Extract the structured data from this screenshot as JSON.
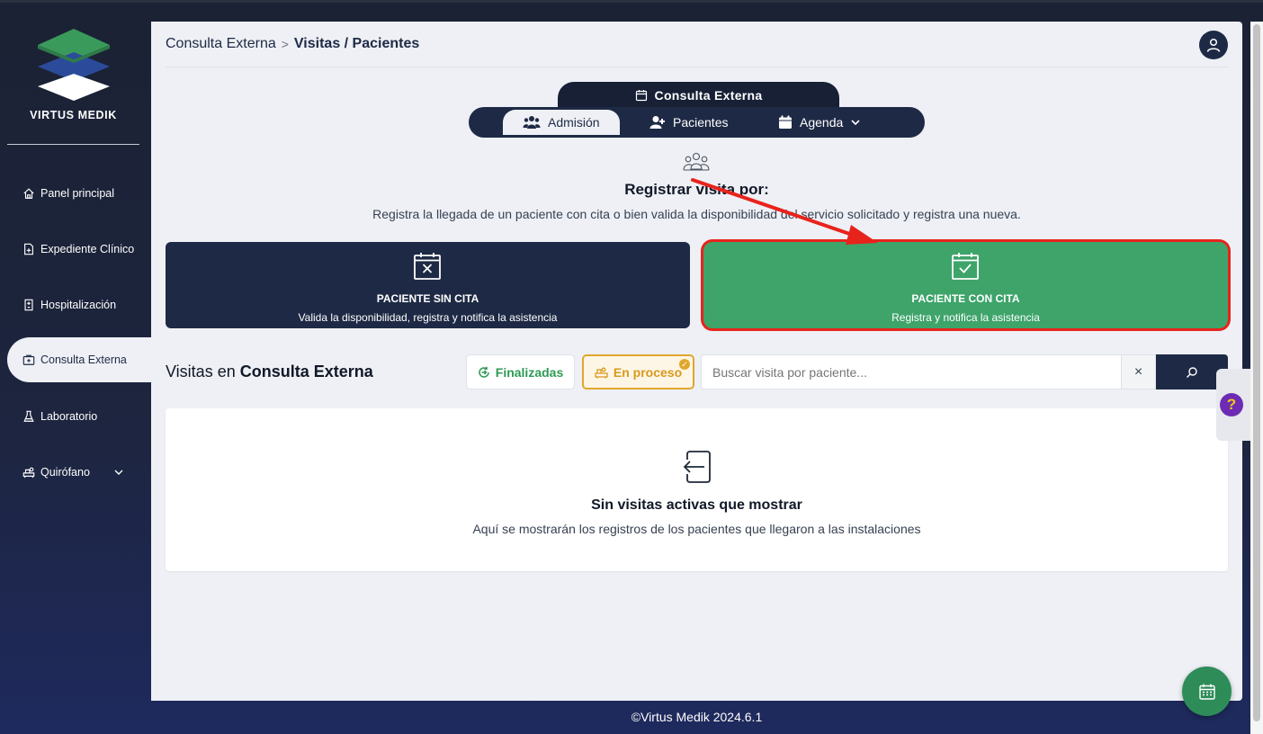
{
  "sidebar": {
    "brand": "VIRTUS MEDIK",
    "items": [
      {
        "label": "Panel principal",
        "icon": "home-icon"
      },
      {
        "label": "Expediente Clínico",
        "icon": "file-plus-icon"
      },
      {
        "label": "Hospitalización",
        "icon": "hospital-icon"
      },
      {
        "label": "Consulta Externa",
        "icon": "clinic-icon",
        "active": true
      },
      {
        "label": "Laboratorio",
        "icon": "flask-icon"
      },
      {
        "label": "Quirófano",
        "icon": "surgery-icon"
      }
    ]
  },
  "header": {
    "breadcrumb_parent": "Consulta Externa",
    "breadcrumb_separator": ">",
    "breadcrumb_current": "Visitas / Pacientes"
  },
  "tabs": {
    "section_title": "Consulta Externa",
    "items": [
      {
        "label": "Admisión",
        "active": true
      },
      {
        "label": "Pacientes"
      },
      {
        "label": "Agenda"
      }
    ]
  },
  "register": {
    "title": "Registrar visita por:",
    "subtitle": "Registra la llegada de un paciente con cita o bien valida la disponibilidad del servicio solicitado y registra una nueva.",
    "card_sin": {
      "title": "PACIENTE SIN CITA",
      "desc": "Valida la disponibilidad, registra y notifica la asistencia"
    },
    "card_con": {
      "title": "PACIENTE CON CITA",
      "desc": "Registra y notifica la asistencia"
    }
  },
  "visits": {
    "title_prefix": "Visitas en ",
    "title_bold": "Consulta Externa",
    "filter_done": "Finalizadas",
    "filter_progress": "En proceso",
    "search_placeholder": "Buscar visita por paciente...",
    "clear_label": "×",
    "empty_title": "Sin visitas activas que mostrar",
    "empty_sub": "Aquí se mostrarán los registros de los pacientes que llegaron a las instalaciones"
  },
  "help_label": "?",
  "footer": "©Virtus Medik 2024.6.1",
  "colors": {
    "navy": "#1e2a45",
    "green": "#3ea46a",
    "highlight": "#e8231c",
    "amber": "#e0a72c",
    "purple": "#6d2bb3"
  }
}
